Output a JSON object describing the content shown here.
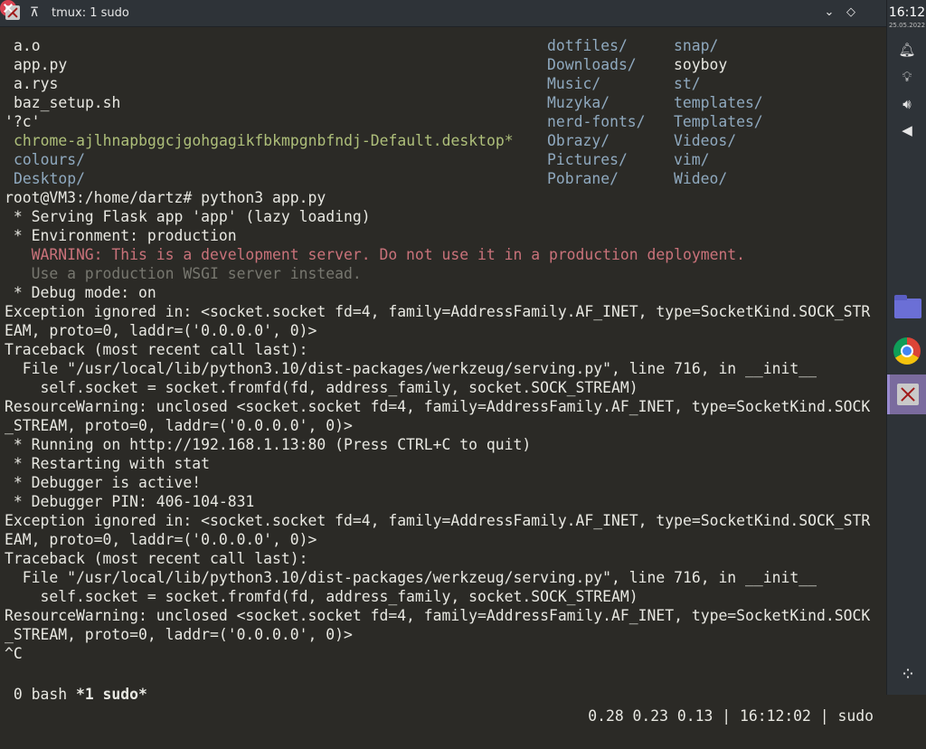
{
  "window": {
    "title": "tmux: 1 sudo"
  },
  "panel": {
    "clock": "16:12",
    "date": "25.05.2022"
  },
  "ls": {
    "col1": [
      "a.o",
      "app.py",
      "a.rys",
      "baz_setup.sh",
      "'?c'",
      "chrome-ajlhnapbggcjgohgagikfbkmpgnbfndj-Default.desktop*",
      "colours/",
      "Desktop/"
    ],
    "col2": [
      "dotfiles/",
      "Downloads/",
      "Music/",
      "Muzyka/",
      "nerd-fonts/",
      "Obrazy/",
      "Pictures/",
      "Pobrane/"
    ],
    "col3": [
      "snap/",
      "soyboy",
      "st/",
      "templates/",
      "Templates/",
      "Videos/",
      "vim/",
      "Wideo/"
    ]
  },
  "output": [
    "root@VM3:/home/dartz# python3 app.py",
    " * Serving Flask app 'app' (lazy loading)",
    " * Environment: production",
    "   WARNING: This is a development server. Do not use it in a production deployment.",
    "   Use a production WSGI server instead.",
    " * Debug mode: on",
    "Exception ignored in: <socket.socket fd=4, family=AddressFamily.AF_INET, type=SocketKind.SOCK_STR",
    "EAM, proto=0, laddr=('0.0.0.0', 0)>",
    "Traceback (most recent call last):",
    "  File \"/usr/local/lib/python3.10/dist-packages/werkzeug/serving.py\", line 716, in __init__",
    "    self.socket = socket.fromfd(fd, address_family, socket.SOCK_STREAM)",
    "ResourceWarning: unclosed <socket.socket fd=4, family=AddressFamily.AF_INET, type=SocketKind.SOCK",
    "_STREAM, proto=0, laddr=('0.0.0.0', 0)>",
    " * Running on http://192.168.1.13:80 (Press CTRL+C to quit)",
    " * Restarting with stat",
    " * Debugger is active!",
    " * Debugger PIN: 406-104-831",
    "Exception ignored in: <socket.socket fd=4, family=AddressFamily.AF_INET, type=SocketKind.SOCK_STR",
    "EAM, proto=0, laddr=('0.0.0.0', 0)>",
    "Traceback (most recent call last):",
    "  File \"/usr/local/lib/python3.10/dist-packages/werkzeug/serving.py\", line 716, in __init__",
    "    self.socket = socket.fromfd(fd, address_family, socket.SOCK_STREAM)",
    "ResourceWarning: unclosed <socket.socket fd=4, family=AddressFamily.AF_INET, type=SocketKind.SOCK",
    "_STREAM, proto=0, laddr=('0.0.0.0', 0)>",
    "^C"
  ],
  "statusbar": {
    "win0": " 0 bash",
    "win1": "*1 sudo*",
    "right": "0.28 0.23 0.13 | 16:12:02 | sudo"
  },
  "colors": {
    "dir": "#8fa9bf",
    "exec": "#aebf7a",
    "warning": "#c9727a",
    "dim": "#77776f"
  },
  "icons": {
    "titlebar": [
      "terminal-app-icon",
      "pin-icon",
      "minimize-icon",
      "maximize-icon",
      "close-icon"
    ],
    "panel": [
      "bell-icon",
      "lightbulb-icon",
      "volume-icon",
      "arrow-left-icon",
      "files-icon",
      "chrome-icon",
      "terminal-icon",
      "launcher-icon"
    ]
  }
}
